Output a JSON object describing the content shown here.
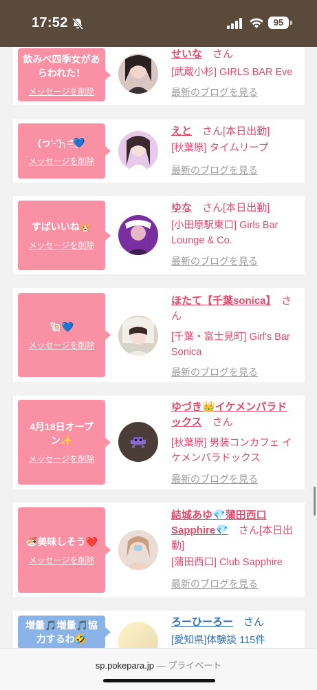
{
  "status_bar": {
    "time": "17:52",
    "battery": "95"
  },
  "url_bar": {
    "domain": "sp.pokepara.jp",
    "mode": "— プライベート"
  },
  "delete_label": "メッセージを削除",
  "blog_label": "最新のブログを見る",
  "san_label": "さん",
  "cards": [
    {
      "message": "飲みベ四季女があらわれた！",
      "name": "せいな",
      "after_name": "",
      "shop": "[武蔵小杉] GIRLS BAR Eve"
    },
    {
      "message": "(っ'-')╮=͟͟͞͞💙",
      "name": "えと",
      "after_name": "[本日出勤]",
      "shop": "[秋葉原] タイムリープ"
    },
    {
      "message": "すばいいね🐹",
      "name": "ゆな",
      "after_name": "[本日出勤]",
      "shop": "[小田原駅東口] Girls Bar Lounge & Co."
    },
    {
      "message": "🐚💙",
      "name": "ほたて【千葉sonica】",
      "after_name": "",
      "shop": "[千葉・富士見町] Girl's Bar Sonica"
    },
    {
      "message": "4月18日オープン✨",
      "name": "ゆづき👑イケメンパラドックス",
      "after_name": "",
      "shop": "[秋葉原] 男装コンカフェ イケメンパラドックス"
    },
    {
      "message": "🍜美味しそう❤️",
      "name": "結城あゆ💎蒲田西口Sapphire💎",
      "after_name": "[本日出勤]",
      "shop": "[蒲田西口] Club Sapphire"
    },
    {
      "message": "増量🎵増量🎵協力するわ🤣",
      "name": "ろーひーろー",
      "after_name": "",
      "shop": "[愛知県]体験談 115件"
    }
  ],
  "colors": {
    "accent_pink": "#f990a4",
    "name_red": "#e04b6c",
    "accent_blue": "#8ab4e8",
    "link_blue": "#2a6ebd",
    "status_bg": "#5a4a3c"
  }
}
